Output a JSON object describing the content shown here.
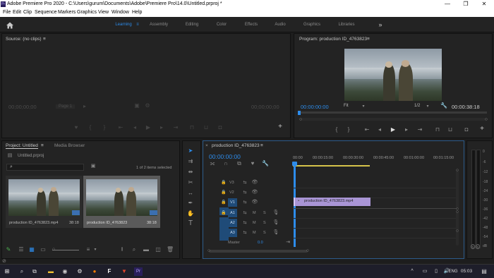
{
  "window": {
    "app_icon": "Pr",
    "title": "Adobe Premiere Pro 2020 - C:\\Users\\gurum\\Documents\\Adobe\\Premiere Pro\\14.0\\Untitled.prproj *",
    "minimize": "—",
    "restore": "❐",
    "close": "✕"
  },
  "menu": [
    "File",
    "Edit",
    "Clip",
    "Sequence",
    "Markers",
    "Graphics",
    "View",
    "Window",
    "Help"
  ],
  "workspaces": {
    "items": [
      "Learning",
      "Assembly",
      "Editing",
      "Color",
      "Effects",
      "Audio",
      "Graphics",
      "Libraries"
    ],
    "active": "Learning",
    "menu_icon": "≡",
    "overflow": "»"
  },
  "source": {
    "title": "Source: (no clips)",
    "menu": "≡",
    "timecode_left": "00;00;00;00",
    "page": "Page 1",
    "timecode_right": "00;00;00;00"
  },
  "program": {
    "title": "Program: production ID_4763823",
    "menu": "≡",
    "timecode": "00:00:00:00",
    "fit": "Fit",
    "resolution": "1/2",
    "duration": "00:00:38:18"
  },
  "project": {
    "tab": "Project: Untitled",
    "menu": "≡",
    "tab2": "Media Browser",
    "file": "Untitled.prproj",
    "search_placeholder": "",
    "items_selected": "1 of 2 items selected",
    "items": [
      {
        "name": "production ID_4763823.mp4",
        "duration": "38:18"
      },
      {
        "name": "production ID_4763823",
        "duration": "38:18"
      }
    ]
  },
  "timeline": {
    "close": "×",
    "title": "production ID_4763823",
    "menu": "≡",
    "timecode": "00:00:00:00",
    "ruler": [
      "00:00",
      "00:00:15:00",
      "00:00:30:00",
      "00:00:45:00",
      "00:01:00:00",
      "00:01:15:00"
    ],
    "video_tracks": [
      "V3",
      "V2",
      "V1"
    ],
    "audio_tracks": [
      "A1",
      "A2",
      "A3"
    ],
    "target_v": "V1",
    "target_a": [
      "A1",
      "A2",
      "A3"
    ],
    "clip_label": "production ID_4763823.mp4",
    "master": "Master",
    "master_value": "0.0",
    "M": "M",
    "S": "S"
  },
  "meters": {
    "scale": [
      "0",
      "-6",
      "-12",
      "-18",
      "-24",
      "-30",
      "-36",
      "-42",
      "-48",
      "-54",
      "dB"
    ],
    "solo": "S"
  },
  "taskbar": {
    "lang": "ENG",
    "time": "05:03"
  },
  "status_icon": "⊘"
}
